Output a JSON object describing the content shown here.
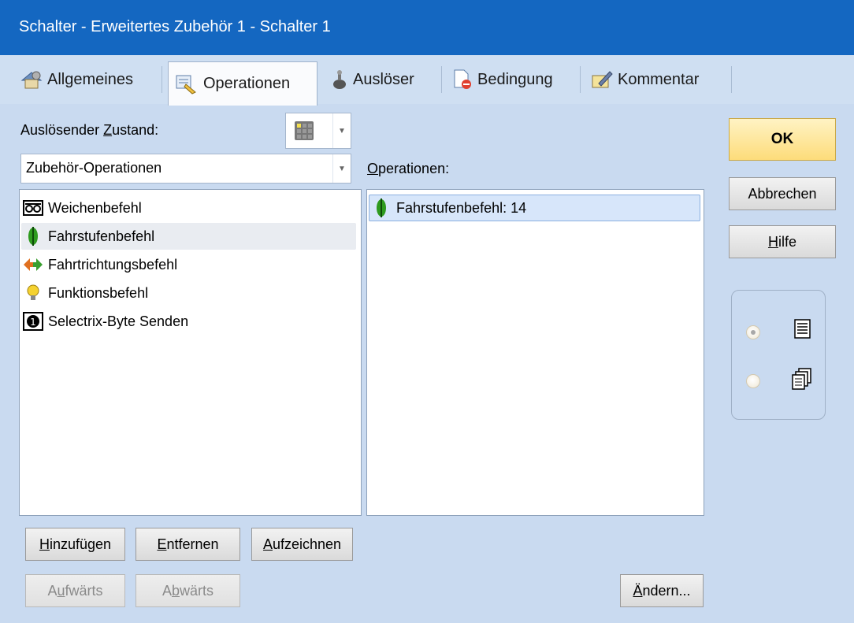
{
  "window": {
    "title": "Schalter - Erweitertes Zubehör 1 - Schalter 1"
  },
  "tabs": [
    {
      "label": "Allgemeines",
      "icon": "settings-house-icon",
      "active": false
    },
    {
      "label": "Operationen",
      "icon": "operations-icon",
      "active": true
    },
    {
      "label": "Auslöser",
      "icon": "trigger-icon",
      "active": false
    },
    {
      "label": "Bedingung",
      "icon": "condition-icon",
      "active": false
    },
    {
      "label": "Kommentar",
      "icon": "comment-icon",
      "active": false
    }
  ],
  "left": {
    "trigger_state_label_pre": "Auslösender ",
    "trigger_state_label_u": "Z",
    "trigger_state_label_post": "ustand:",
    "category": {
      "value": "Zubehör-Operationen"
    },
    "commands": [
      {
        "label": "Weichenbefehl",
        "icon": "switch-command-icon",
        "state": "normal"
      },
      {
        "label": "Fahrstufenbefehl",
        "icon": "speed-step-icon",
        "state": "hover"
      },
      {
        "label": "Fahrtrichtungsbefehl",
        "icon": "direction-arrows-icon",
        "state": "normal"
      },
      {
        "label": "Funktionsbefehl",
        "icon": "lightbulb-icon",
        "state": "normal"
      },
      {
        "label": "Selectrix-Byte Senden",
        "icon": "selectrix-byte-icon",
        "state": "normal"
      }
    ]
  },
  "right": {
    "operations_label_u": "O",
    "operations_label_post": "perationen:",
    "operations": [
      {
        "label": "Fahrstufenbefehl: 14",
        "icon": "speed-step-icon",
        "selected": true
      }
    ]
  },
  "buttons": {
    "ok": "OK",
    "cancel": "Abbrechen",
    "help_u": "H",
    "help_post": "ilfe",
    "add_u": "H",
    "add_post": "inzufügen",
    "remove_u": "E",
    "remove_post": "ntfernen",
    "record_u": "A",
    "record_post": "ufzeichnen",
    "up_pre": "A",
    "up_u": "u",
    "up_post": "fwärts",
    "down_pre": "A",
    "down_u": "b",
    "down_post": "wärts",
    "change_u": "Ä",
    "change_post": "ndern..."
  },
  "view": {
    "options": [
      {
        "icon": "list-view-icon",
        "checked": true
      },
      {
        "icon": "copy-view-icon",
        "checked": false
      }
    ]
  },
  "colors": {
    "titlebar": "#1467c1",
    "background": "#c9daf0",
    "ok_button": "#fddc7a",
    "selection": "#d7e6fa"
  }
}
